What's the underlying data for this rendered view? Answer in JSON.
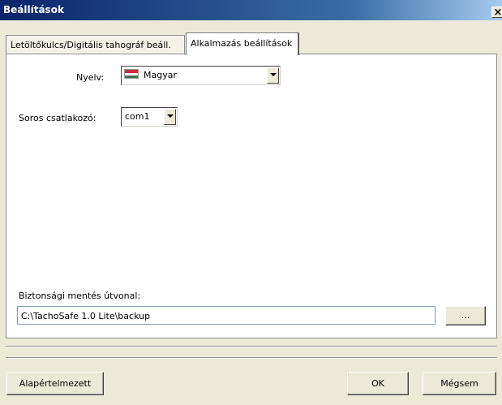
{
  "window": {
    "title": "Beállítások",
    "close_glyph": "×"
  },
  "tabs": [
    {
      "label": "Letöltőkulcs/Digitális tahográf beáll.",
      "active": false
    },
    {
      "label": "Alkalmazás beállítások",
      "active": true
    }
  ],
  "language": {
    "label": "Nyelv:",
    "value": "Magyar",
    "flag_icon": "hungarian-flag-icon"
  },
  "serial": {
    "label": "Soros csatlakozó:",
    "value": "com1"
  },
  "backup": {
    "label": "Biztonsági mentés útvonal:",
    "path": "C:\\TachoSafe 1.0 Lite\\backup",
    "browse_label": "..."
  },
  "buttons": {
    "default_label": "Alapértelmezett",
    "ok_label": "OK",
    "cancel_label": "Mégsem"
  },
  "colors": {
    "titlebar_start": "#0a246a",
    "titlebar_end": "#a6caf0",
    "face": "#ece9d8",
    "flag_red": "#cd2a3e",
    "flag_green": "#436f4d"
  }
}
